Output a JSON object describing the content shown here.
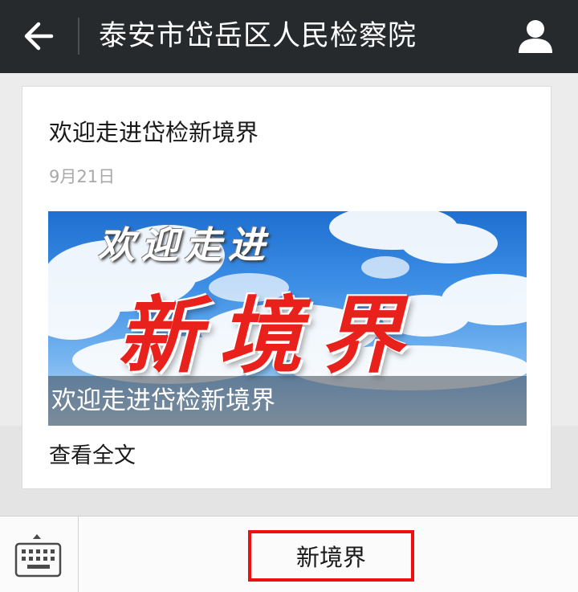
{
  "header": {
    "title": "泰安市岱岳区人民检察院",
    "back_icon": "arrow-left-icon",
    "profile_icon": "user-profile-icon"
  },
  "article": {
    "title": "欢迎走进岱检新境界",
    "date": "9月21日",
    "cover": {
      "small_text": "欢迎走进",
      "big_text": "新境界",
      "caption": "欢迎走进岱检新境界"
    },
    "read_more": "查看全文"
  },
  "bottom_menu": {
    "keyboard_icon": "keyboard-icon",
    "items": [
      {
        "label": "新境界"
      }
    ]
  },
  "colors": {
    "topbar_bg": "#262a2d",
    "highlight_border": "#ee1010",
    "cover_text_red": "#e8211c"
  }
}
